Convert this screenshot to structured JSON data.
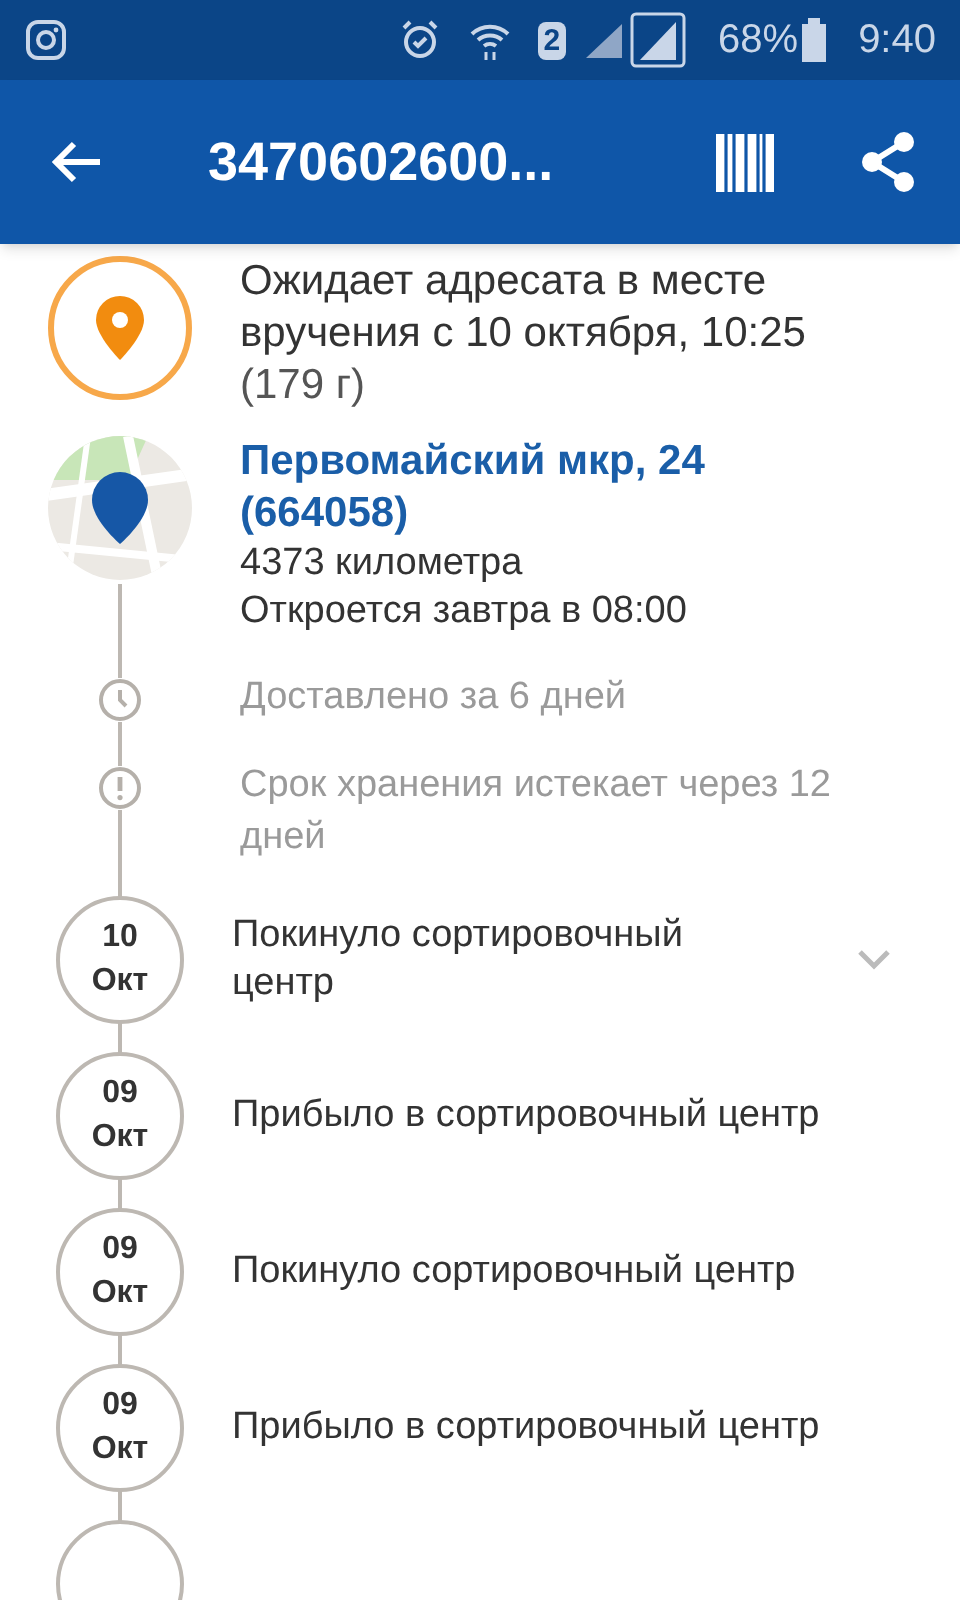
{
  "status_bar": {
    "sim": "2",
    "battery": "68%",
    "time": "9:40"
  },
  "app_bar": {
    "title": "3470602600..."
  },
  "current": {
    "status": "Ожидает адресата в месте вручения с 10 октября, 10:25",
    "weight": "(179 г)"
  },
  "office": {
    "address": "Первомайский мкр, 24",
    "postcode": "(664058)",
    "distance": "4373 километра",
    "hours": "Откроется завтра в 08:00"
  },
  "notes": [
    {
      "kind": "clock",
      "text": "Доставлено за 6 дней"
    },
    {
      "kind": "alert",
      "text": "Срок хранения истекает через 12 дней"
    }
  ],
  "events": [
    {
      "day": "10",
      "month": "Окт",
      "text": "Покинуло сортировочный центр",
      "expandable": true
    },
    {
      "day": "09",
      "month": "Окт",
      "text": "Прибыло в сортировочный центр",
      "expandable": false
    },
    {
      "day": "09",
      "month": "Окт",
      "text": "Покинуло сортировочный центр",
      "expandable": false
    },
    {
      "day": "09",
      "month": "Окт",
      "text": "Прибыло в сортировочный центр",
      "expandable": false
    }
  ]
}
